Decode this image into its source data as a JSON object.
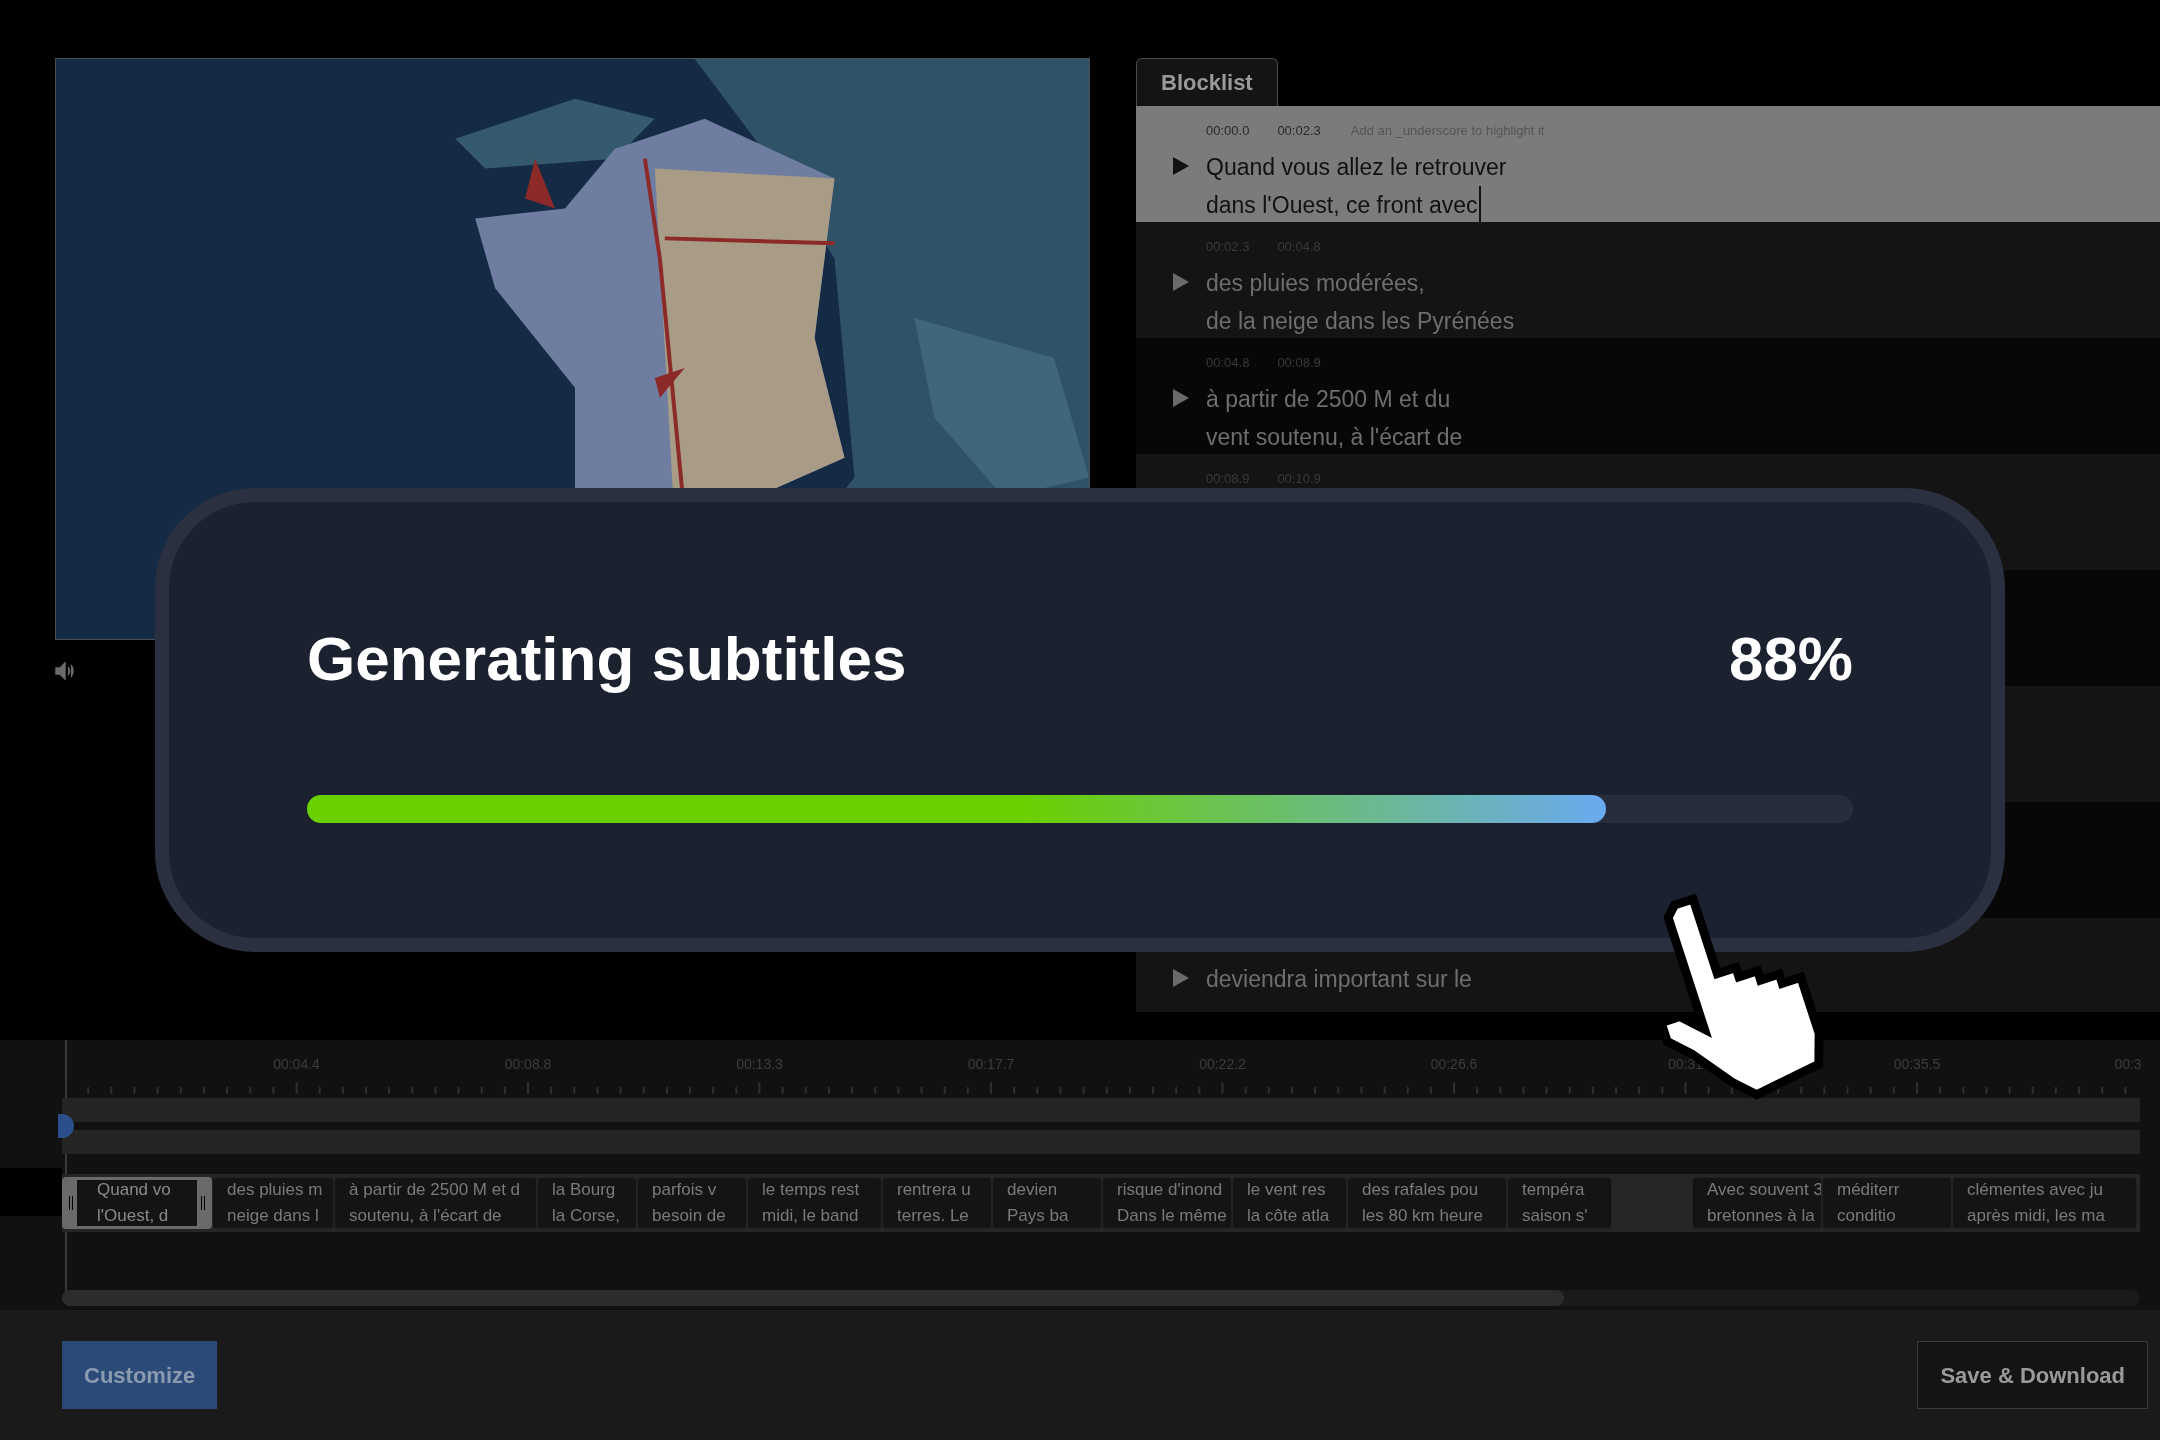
{
  "blocklist": {
    "tab": {
      "label": "Blocklist",
      "selected": true
    },
    "rows": [
      {
        "selected": true,
        "start": "00:00.0",
        "end": "00:02.3",
        "hint": "Add an _underscore to highlight it",
        "lines": [
          "Quand vous allez le retrouver",
          "dans l'Ouest, ce front avec"
        ],
        "editing": true
      },
      {
        "selected": false,
        "start": "00:02.3",
        "end": "00:04.8",
        "lines": [
          "des pluies modérées,",
          "de la neige dans les Pyrénées"
        ]
      },
      {
        "selected": false,
        "start": "00:04.8",
        "end": "00:08.9",
        "lines": [
          "à partir de 2500 M et du",
          "vent soutenu, à l'écart de"
        ]
      },
      {
        "selected": false,
        "start": "00:08.9",
        "end": "00:10.9"
      },
      {
        "selected": false
      },
      {
        "selected": false
      },
      {
        "selected": false
      },
      {
        "selected": false,
        "lines": [
          "deviendra important sur le"
        ]
      }
    ]
  },
  "progress_dialog": {
    "title": "Generating subtitles",
    "percent": "88%",
    "level": 0.84
  },
  "timeline": {
    "ruler": [
      "00:04.4",
      "00:08.8",
      "00:13.3",
      "00:17.7",
      "00:22.2",
      "00:26.6",
      "00:31",
      "00:35.5",
      "00:3"
    ],
    "blocks": [
      {
        "selected": true,
        "lines": [
          "Quand vo",
          "l'Ouest, d"
        ]
      },
      {
        "selected": false,
        "lines": [
          "des pluies m",
          "neige dans l"
        ]
      },
      {
        "selected": false,
        "lines": [
          "à partir de 2500 M et d",
          "soutenu, à l'écart de"
        ]
      },
      {
        "selected": false,
        "lines": [
          "la Bourg",
          "la Corse,"
        ]
      },
      {
        "selected": false,
        "lines": [
          "parfois v",
          "besoin de"
        ]
      },
      {
        "selected": false,
        "lines": [
          "le temps rest",
          "midi, le band"
        ]
      },
      {
        "selected": false,
        "lines": [
          "rentrera u",
          "terres. Le"
        ]
      },
      {
        "selected": false,
        "lines": [
          "devien",
          "Pays ba"
        ]
      },
      {
        "selected": false,
        "lines": [
          "risque d'inond",
          "Dans le même"
        ]
      },
      {
        "selected": false,
        "lines": [
          "le vent res",
          "la côte atla"
        ]
      },
      {
        "selected": false,
        "lines": [
          "des rafales pou",
          "les 80 km heure"
        ]
      },
      {
        "selected": false,
        "lines": [
          "tempéra",
          "saison s'"
        ]
      },
      {
        "selected": false,
        "lines": [
          "Avec souvent 3",
          "bretonnes à la"
        ]
      },
      {
        "selected": false,
        "lines": [
          "méditerr",
          "conditio"
        ]
      },
      {
        "selected": false,
        "lines": [
          "clémentes avec ju",
          "après midi, les ma"
        ]
      }
    ]
  },
  "buttons": [
    {
      "kind": "primary",
      "label": "Customize"
    },
    {
      "kind": "outline",
      "label": "Save & Download"
    }
  ]
}
